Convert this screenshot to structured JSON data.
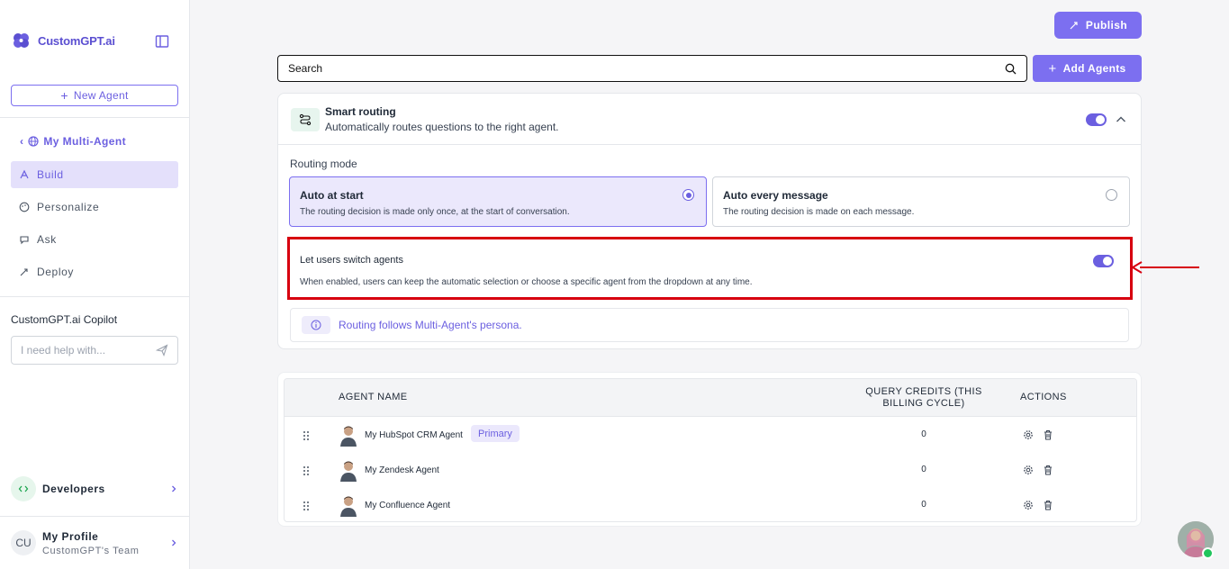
{
  "app": {
    "brand": "CustomGPT.ai"
  },
  "sidebar": {
    "new_agent_label": "New Agent",
    "back_label": "My Multi-Agent",
    "nav": [
      {
        "label": "Build",
        "icon": "build-icon",
        "active": true
      },
      {
        "label": "Personalize",
        "icon": "palette-icon",
        "active": false
      },
      {
        "label": "Ask",
        "icon": "chat-icon",
        "active": false
      },
      {
        "label": "Deploy",
        "icon": "rocket-icon",
        "active": false
      }
    ],
    "copilot_title": "CustomGPT.ai Copilot",
    "copilot_placeholder": "I need help with...",
    "developers_label": "Developers",
    "profile": {
      "initials": "CU",
      "name": "My Profile",
      "team": "CustomGPT's Team"
    }
  },
  "header": {
    "publish_label": "Publish"
  },
  "search": {
    "value": "Search"
  },
  "add_agents_label": "Add Agents",
  "routing": {
    "title": "Smart routing",
    "subtitle": "Automatically routes questions to the right agent.",
    "enabled": true,
    "mode_label": "Routing mode",
    "options": [
      {
        "title": "Auto at start",
        "desc": "The routing decision is made only once, at the start of conversation.",
        "selected": true
      },
      {
        "title": "Auto every message",
        "desc": "The routing decision is made on each message.",
        "selected": false
      }
    ],
    "switch": {
      "title": "Let users switch agents",
      "desc": "When enabled, users can keep the automatic selection or choose a specific agent from the dropdown at any time.",
      "enabled": true
    },
    "persona_note": "Routing follows Multi-Agent's persona."
  },
  "table": {
    "headers": {
      "name": "AGENT NAME",
      "credits_line1": "QUERY CREDITS (THIS",
      "credits_line2": "BILLING CYCLE)",
      "actions": "ACTIONS"
    },
    "rows": [
      {
        "name": "My HubSpot CRM Agent",
        "badge": "Primary",
        "credits": "0"
      },
      {
        "name": "My Zendesk Agent",
        "badge": "",
        "credits": "0"
      },
      {
        "name": "My Confluence Agent",
        "badge": "",
        "credits": "0"
      }
    ]
  },
  "colors": {
    "accent": "#7c6ff0",
    "highlight": "#d7000f",
    "online": "#21c55d"
  }
}
